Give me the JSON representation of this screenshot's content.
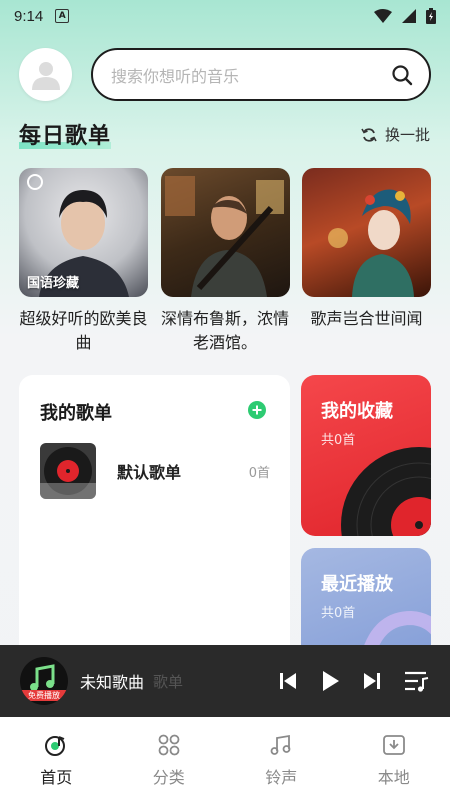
{
  "status_bar": {
    "time": "9:14",
    "notification_badge": "A"
  },
  "search": {
    "placeholder": "搜索你想听的音乐"
  },
  "daily": {
    "title": "每日歌单",
    "refresh_label": "换一批",
    "cards": [
      {
        "title": "超级好听的欧美良曲",
        "tag": "国语珍藏"
      },
      {
        "title": "深情布鲁斯，浓情老酒馆。",
        "tag": ""
      },
      {
        "title": "歌声岂合世间闻",
        "tag": ""
      }
    ]
  },
  "my_playlists": {
    "title": "我的歌单",
    "items": [
      {
        "name": "默认歌单",
        "count": "0首"
      }
    ],
    "behind_player_text": "歌单"
  },
  "favorites": {
    "title": "我的收藏",
    "count": "共0首"
  },
  "recent": {
    "title": "最近播放",
    "count": "共0首"
  },
  "player": {
    "song_title": "未知歌曲",
    "cover_label": "免费播放"
  },
  "nav": [
    {
      "label": "首页",
      "icon": "home-music-icon",
      "active": true
    },
    {
      "label": "分类",
      "icon": "category-grid-icon",
      "active": false
    },
    {
      "label": "铃声",
      "icon": "ringtone-note-icon",
      "active": false
    },
    {
      "label": "本地",
      "icon": "local-download-icon",
      "active": false
    }
  ],
  "colors": {
    "accent_green": "#2dcb72",
    "favorites_red": "#e8343a",
    "recent_blue": "#8fa6dc",
    "player_bg": "#2a2a2a"
  }
}
